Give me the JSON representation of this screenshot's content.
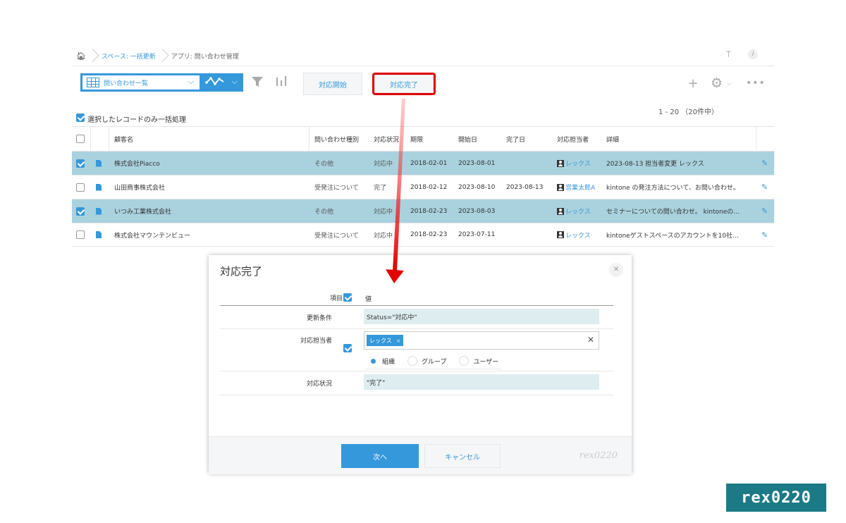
{
  "breadcrumb": {
    "space": "スペース: 一括更新",
    "app": "アプリ: 問い合わせ管理"
  },
  "toolbar": {
    "view_label": "問い合わせ一覧",
    "start_label": "対応開始",
    "done_label": "対応完了"
  },
  "count_text": "1 - 20 （20件中）",
  "bulk_label": "選択したレコードのみ一括処理",
  "table": {
    "headers": {
      "name": "顧客名",
      "type": "問い合わせ種別",
      "status": "対応状況",
      "limit": "期限",
      "start": "開始日",
      "end": "完了日",
      "person": "対応担当者",
      "detail": "詳細"
    },
    "rows": [
      {
        "checked": true,
        "name": "株式会社Piacco",
        "type": "その他",
        "status": "対応中",
        "limit": "2018-02-01",
        "start": "2023-08-01",
        "end": "",
        "person": "レックス",
        "detail": "2023-08-13 担当者変更 レックス"
      },
      {
        "checked": false,
        "name": "山田商事株式会社",
        "type": "受発注について",
        "status": "完了",
        "limit": "2018-02-12",
        "start": "2023-08-10",
        "end": "2023-08-13",
        "person": "営業太郎A",
        "detail": "kintone の発注方法について、お問い合わせ。"
      },
      {
        "checked": true,
        "name": "いつみ工業株式会社",
        "type": "その他",
        "status": "対応中",
        "limit": "2018-02-23",
        "start": "2023-08-03",
        "end": "",
        "person": "レックス",
        "detail": "セミナーについての問い合わせ。 kintoneの…"
      },
      {
        "checked": false,
        "name": "株式会社マウンテンビュー",
        "type": "受発注について",
        "status": "対応中",
        "limit": "2018-02-23",
        "start": "2023-07-11",
        "end": "",
        "person": "レックス",
        "detail": "kintoneゲストスペースのアカウントを10社…"
      }
    ]
  },
  "dialog": {
    "title": "対応完了",
    "head_item": "項目",
    "head_value": "値",
    "condition_label": "更新条件",
    "condition_value": "Status=\"対応中\"",
    "person_label": "対応担当者",
    "person_tag": "レックス",
    "radio_options": [
      "組織",
      "グループ",
      "ユーザー"
    ],
    "status_label": "対応状況",
    "status_value": "\"完了\"",
    "next_label": "次へ",
    "cancel_label": "キャンセル",
    "watermark": "rex0220"
  },
  "brand": "rex0220",
  "colors": {
    "accent": "#3498db",
    "selected_row": "#a9d2de",
    "highlight_border": "#e00000",
    "brand_bg": "#1c7a86"
  }
}
